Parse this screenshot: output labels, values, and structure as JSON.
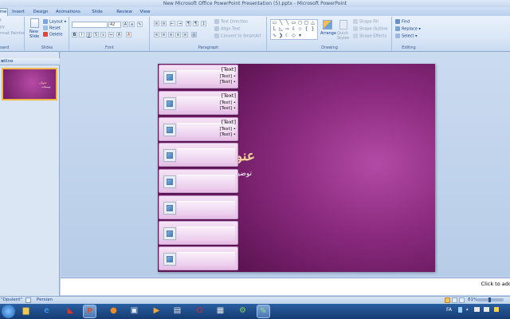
{
  "window": {
    "title": "New Microsoft Office PowerPoint Presentation (5).pptx - Microsoft PowerPoint"
  },
  "tabs": [
    "me",
    "Insert",
    "Design",
    "Animations",
    "Slide Show",
    "Review",
    "View"
  ],
  "ribbon": {
    "clipboard": {
      "label": "oard",
      "cut": "t",
      "copy": "py",
      "format_painter": "rmat Painter"
    },
    "slides": {
      "label": "Slides",
      "new_slide": "New Slide",
      "layout": "Layout",
      "reset": "Reset",
      "delete": "Delete"
    },
    "font": {
      "label": "Font",
      "size": "42"
    },
    "paragraph": {
      "label": "Paragraph",
      "text_direction": "Text Direction",
      "align_text": "Align Text",
      "convert_smartart": "Convert to SmartArt"
    },
    "drawing": {
      "label": "Drawing",
      "arrange": "Arrange",
      "quick_styles": "Quick Styles",
      "shape_fill": "Shape Fill",
      "shape_outline": "Shape Outline",
      "shape_effects": "Shape Effects"
    },
    "editing": {
      "label": "Editing",
      "find": "Find",
      "replace": "Replace",
      "select": "Select"
    }
  },
  "left_pane": {
    "tab_label": "utline",
    "close": "×"
  },
  "thumbnail": {
    "title": "عنوان",
    "subtitle": "توضيحات"
  },
  "slide": {
    "title": "عنوان",
    "subtitle": "توضيحات",
    "items": [
      {
        "line1": "[Text]",
        "line2": "[Text] •",
        "line3": "[Text] •"
      },
      {
        "line1": "[Text]",
        "line2": "[Text] •",
        "line3": "[Text] •"
      },
      {
        "line1": "[Text]",
        "line2": "[Text] •",
        "line3": "[Text] •"
      },
      {
        "line1": "",
        "line2": "",
        "line3": ""
      },
      {
        "line1": "",
        "line2": "",
        "line3": ""
      },
      {
        "line1": "",
        "line2": "",
        "line3": ""
      },
      {
        "line1": "",
        "line2": "",
        "line3": ""
      },
      {
        "line1": "",
        "line2": "",
        "line3": ""
      }
    ]
  },
  "notes": {
    "placeholder": "Click to add"
  },
  "status": {
    "theme": "\"Opulent\"",
    "language": "Persian",
    "zoom": "81%"
  },
  "tray": {
    "lang": "FA"
  },
  "taskbar": {
    "icons": [
      "windows-explorer-icon",
      "internet-explorer-icon",
      "avira-icon",
      "powerpoint-icon",
      "firefox-icon",
      "window-icon",
      "media-player-icon",
      "notepad-icon",
      "opera-icon",
      "settings-icon",
      "paint-icon"
    ]
  }
}
